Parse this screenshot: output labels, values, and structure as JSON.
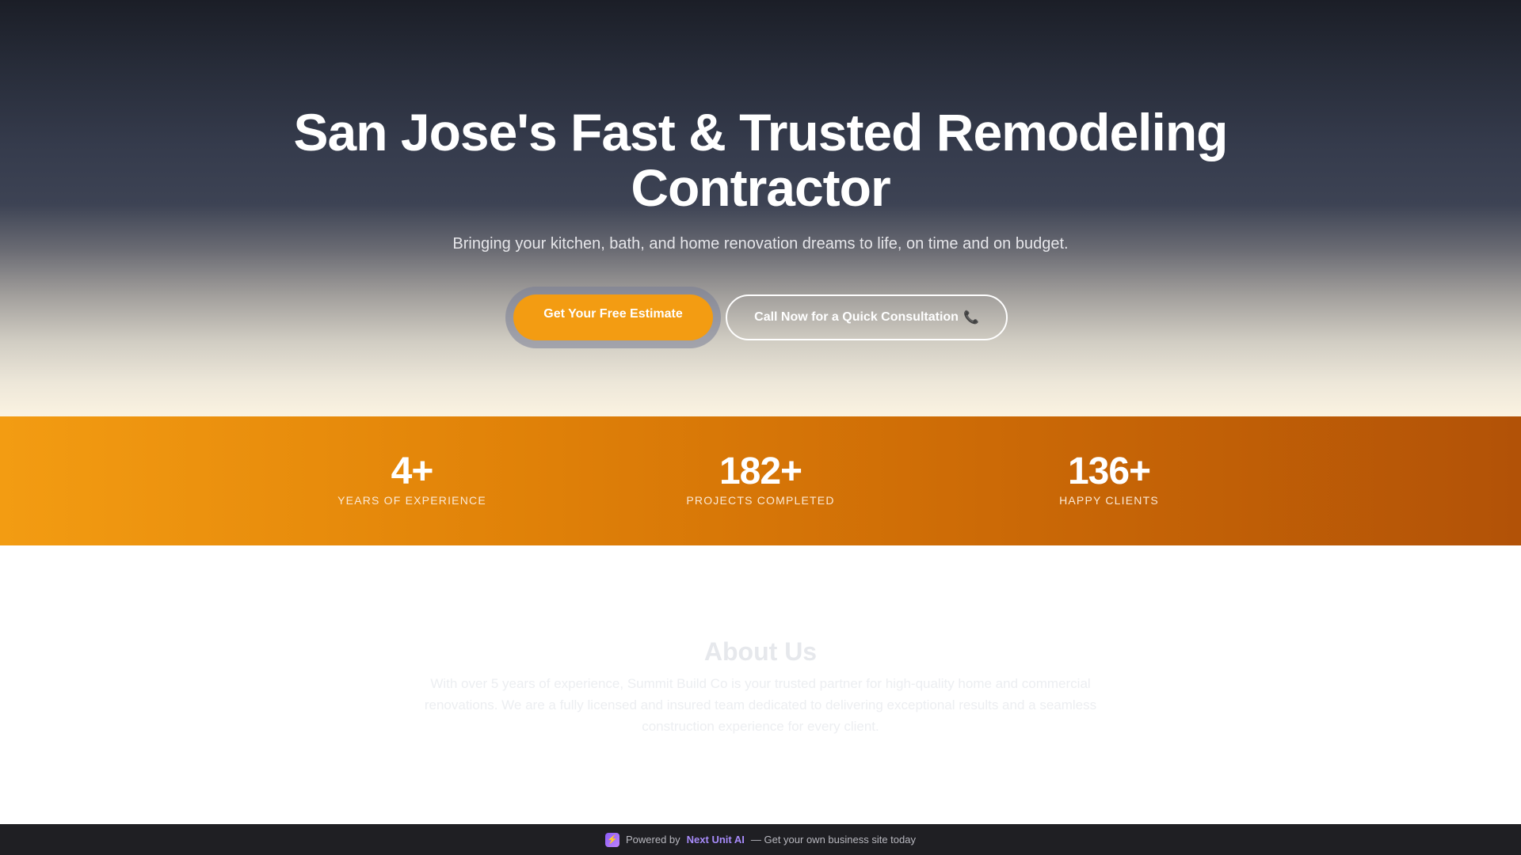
{
  "hero": {
    "title": "San Jose's Fast & Trusted Remodeling Contractor",
    "subtitle": "Bringing your kitchen, bath, and home renovation dreams to life, on time and on budget.",
    "primary_button": "Get Your Free Estimate",
    "secondary_button": "Call Now for a Quick Consultation",
    "secondary_icon": "phone-icon"
  },
  "stats": [
    {
      "value": "4+",
      "label": "YEARS OF EXPERIENCE"
    },
    {
      "value": "182+",
      "label": "PROJECTS COMPLETED"
    },
    {
      "value": "136+",
      "label": "HAPPY CLIENTS"
    }
  ],
  "about": {
    "title": "About Us",
    "text": "With over 5 years of experience, Summit Build Co is your trusted partner for high-quality home and commercial renovations. We are a fully licensed and insured team dedicated to delivering exceptional results and a seamless construction experience for every client."
  },
  "footer": {
    "prefix": "Powered by",
    "brand": "Next Unit AI",
    "suffix": "— Get your own business site today",
    "icon": "bolt-icon"
  },
  "colors": {
    "accent": "#f39c12",
    "stats_end": "#b25207",
    "footer_bg": "#1f1f23",
    "brand": "#a78bfa"
  }
}
